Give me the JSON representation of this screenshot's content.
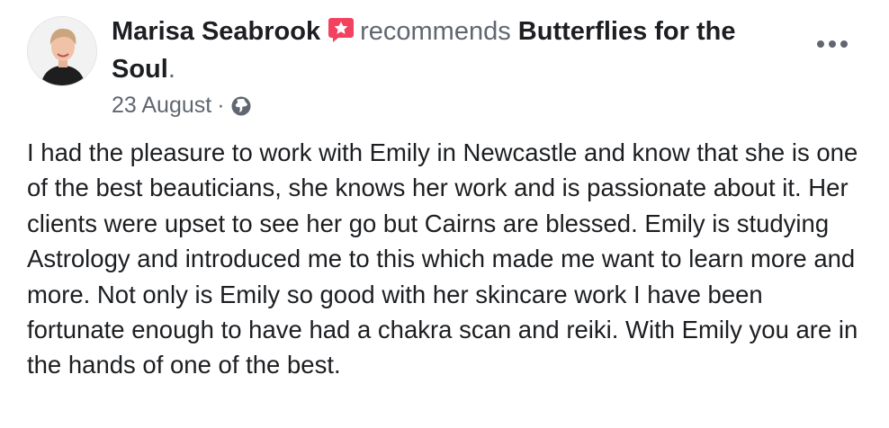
{
  "post": {
    "author": "Marisa Seabrook",
    "verb": "recommends",
    "page_name": "Butterflies for the Soul",
    "period": ".",
    "date": "23 August",
    "separator": "·",
    "audience_icon": "globe-icon",
    "recommend_icon": "recommend-star-icon",
    "more_icon": "more-options-icon",
    "text": "I had the pleasure to work with Emily in Newcastle and know that she is one of the best beauticians, she knows her work and is passionate about it. Her clients were upset to see her go but Cairns are blessed. Emily is studying Astrology and introduced me to this which made me want to learn more and more. Not only is Emily so good with her skincare work I have been fortunate enough to have had a chakra scan and reiki. With Emily you are in the hands of one of the best."
  },
  "colors": {
    "text_primary": "#1c1e21",
    "text_secondary": "#606770",
    "recommend_accent": "#f3425f"
  }
}
